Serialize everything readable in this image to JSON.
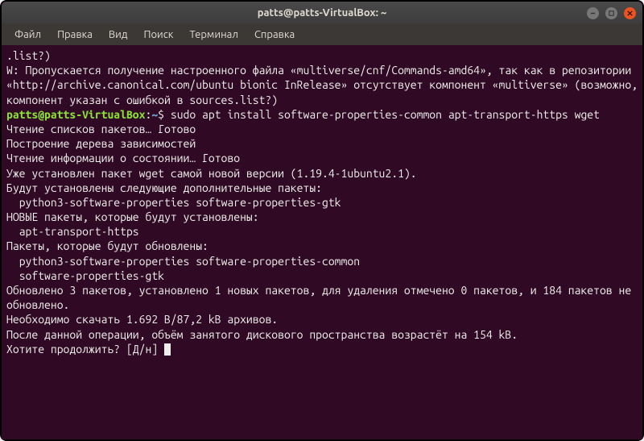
{
  "titlebar": {
    "title": "patts@patts-VirtualBox: ~"
  },
  "menubar": {
    "items": [
      {
        "label": "Файл"
      },
      {
        "label": "Правка"
      },
      {
        "label": "Вид"
      },
      {
        "label": "Поиск"
      },
      {
        "label": "Терминал"
      },
      {
        "label": "Справка"
      }
    ]
  },
  "terminal": {
    "lines": [
      {
        "t": "out",
        "text": ".list?)"
      },
      {
        "t": "out",
        "text": "W: Пропускается получение настроенного файла «multiverse/cnf/Commands-amd64», так как в репозитории «http://archive.canonical.com/ubuntu bionic InRelease» отсутствует компонент «multiverse» (возможно, компонент указан с ошибкой в sources.list?)"
      },
      {
        "t": "prompt",
        "user": "patts@patts-VirtualBox",
        "path": "~",
        "cmd": "sudo apt install software-properties-common apt-transport-https wget"
      },
      {
        "t": "out",
        "text": "Чтение списков пакетов… Готово"
      },
      {
        "t": "out",
        "text": "Построение дерева зависимостей"
      },
      {
        "t": "out",
        "text": "Чтение информации о состоянии… Готово"
      },
      {
        "t": "out",
        "text": "Уже установлен пакет wget самой новой версии (1.19.4-1ubuntu2.1)."
      },
      {
        "t": "out",
        "text": "Будут установлены следующие дополнительные пакеты:"
      },
      {
        "t": "out",
        "text": "  python3-software-properties software-properties-gtk"
      },
      {
        "t": "out",
        "text": "НОВЫЕ пакеты, которые будут установлены:"
      },
      {
        "t": "out",
        "text": "  apt-transport-https"
      },
      {
        "t": "out",
        "text": "Пакеты, которые будут обновлены:"
      },
      {
        "t": "out",
        "text": "  python3-software-properties software-properties-common"
      },
      {
        "t": "out",
        "text": "  software-properties-gtk"
      },
      {
        "t": "out",
        "text": "Обновлено 3 пакетов, установлено 1 новых пакетов, для удаления отмечено 0 пакетов, и 184 пакетов не обновлено."
      },
      {
        "t": "out",
        "text": "Необходимо скачать 1.692 B/87,2 kB архивов."
      },
      {
        "t": "out",
        "text": "После данной операции, объём занятого дискового пространства возрастёт на 154 kB."
      },
      {
        "t": "input",
        "text": "Хотите продолжить? [Д/н] "
      }
    ]
  }
}
